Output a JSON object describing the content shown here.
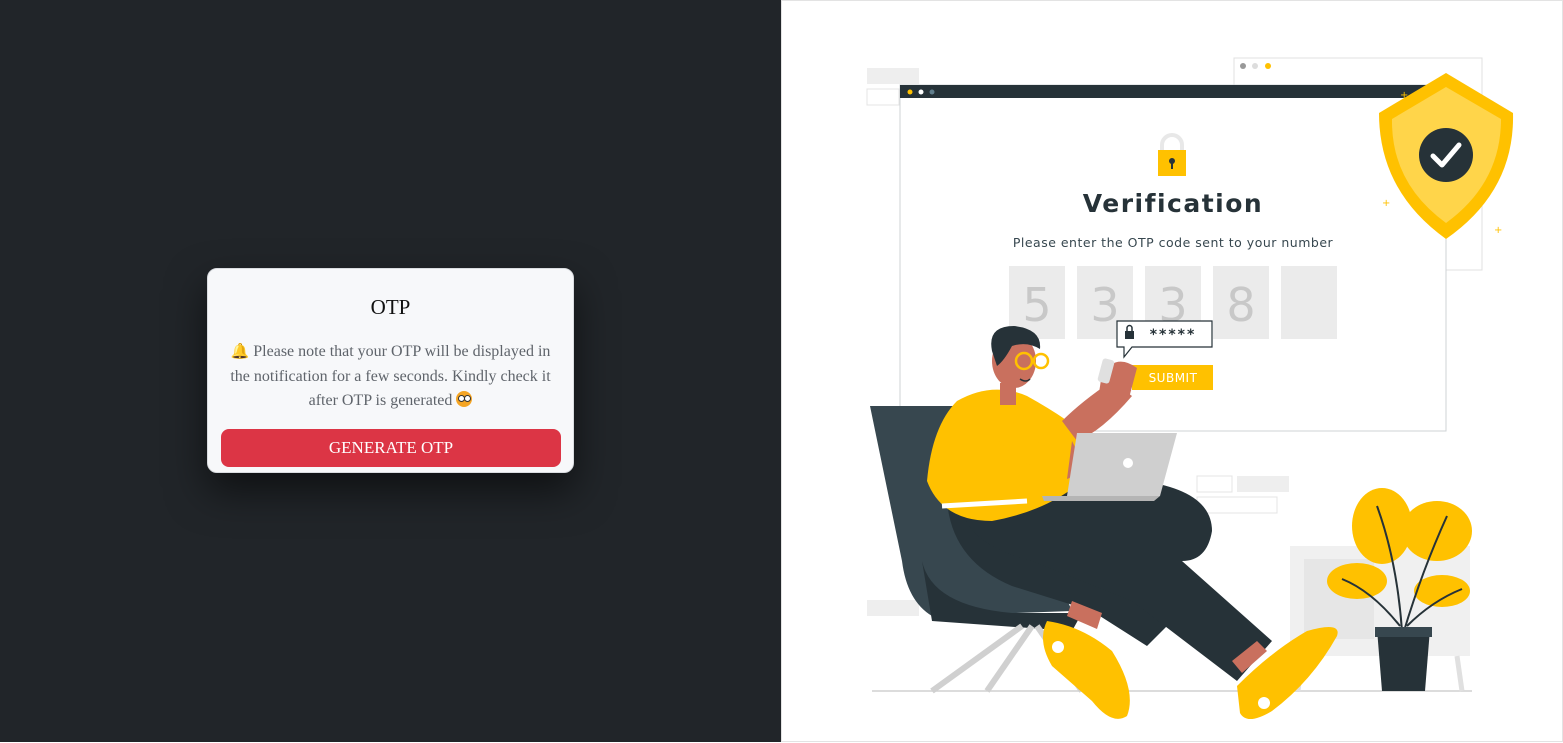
{
  "otp_card": {
    "title": "OTP",
    "note_icon": "bell-icon",
    "note": "Please note that your OTP will be displayed in the notification for a few seconds. Kindly check it after OTP is generated",
    "note_end_icon": "eyes-emoji-icon",
    "button_label": "GENERATE OTP",
    "button_color": "#dc3545"
  },
  "illustration": {
    "heading": "Verification",
    "subtitle": "Please enter the OTP code sent to your number",
    "otp_digits": [
      "5",
      "3",
      "3",
      "8",
      ""
    ],
    "password_mask": "*****",
    "submit_label": "SUBMIT",
    "accent_color": "#ffc100",
    "dark_color": "#263238"
  }
}
